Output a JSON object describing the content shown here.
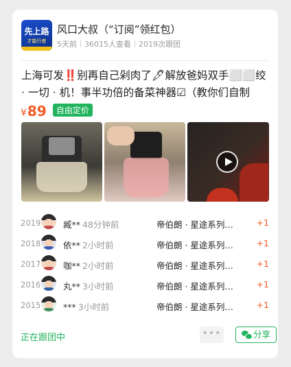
{
  "header": {
    "avatar_line1": "先上路",
    "avatar_line2": "才能行者",
    "title": "风口大叔（“订阅”领红包）",
    "time_ago": "5天前",
    "views": "36015人查看",
    "follows": "2019次跟团"
  },
  "post": {
    "description": "上海可发‼️别再自己剁肉了🖋解放爸妈双手⬜⬜绞 · 一切 · 机！事半功倍的备菜神器☑（教你们自制低…",
    "price_symbol": "¥",
    "price_value": "89",
    "price_tag": "自由定价"
  },
  "media": {
    "video_indicator": "play-icon"
  },
  "followers": [
    {
      "year": "2019",
      "name": "臧**",
      "time": "48分钟前",
      "product": "帝伯朗 · 星途系列…",
      "count": "+1"
    },
    {
      "year": "2018",
      "name": "依**",
      "time": "2小时前",
      "product": "帝伯朗 · 星途系列…",
      "count": "+1"
    },
    {
      "year": "2017",
      "name": "咖**",
      "time": "2小时前",
      "product": "帝伯朗 · 星途系列…",
      "count": "+1"
    },
    {
      "year": "2016",
      "name": "丸**",
      "time": "3小时前",
      "product": "帝伯朗 · 星途系列…",
      "count": "+1"
    },
    {
      "year": "2015",
      "name": "***",
      "time": "3小时前",
      "product": "帝伯朗 · 星途系列…",
      "count": "+1"
    }
  ],
  "footer": {
    "status": "正在跟团中",
    "more_label": "•••",
    "share_label": "分享"
  },
  "colors": {
    "accent_green": "#21b45d",
    "price_orange": "#f25b24",
    "background": "#ededed"
  }
}
